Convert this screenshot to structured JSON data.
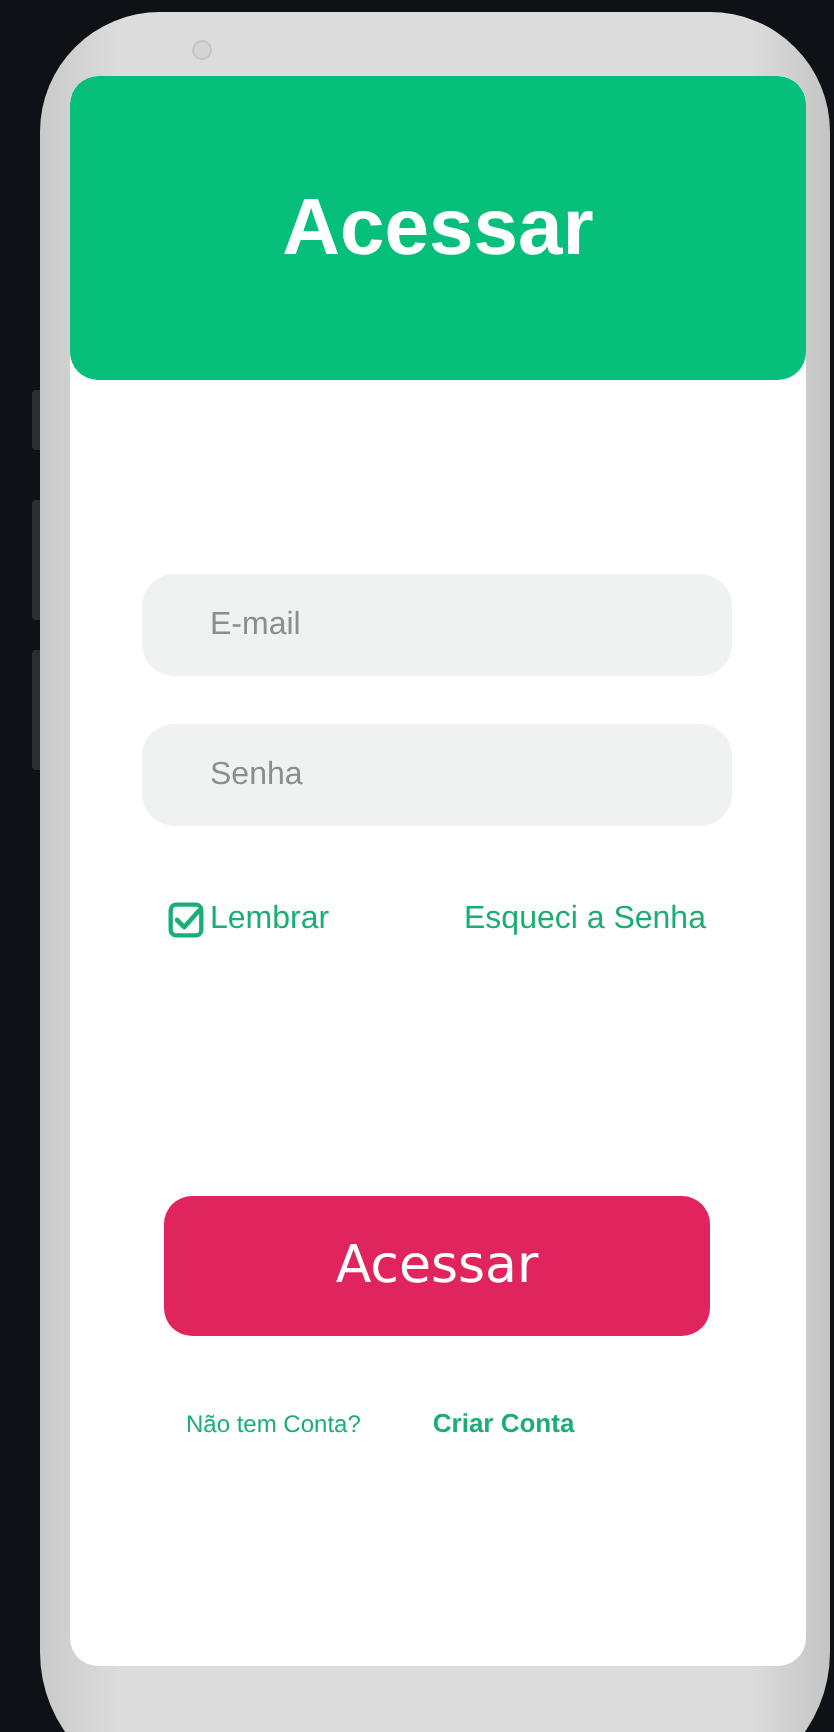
{
  "header": {
    "title": "Acessar"
  },
  "fields": [
    {
      "placeholder": "E-mail"
    },
    {
      "placeholder": "Senha"
    }
  ],
  "remember": {
    "label": "Lembrar",
    "checked": true
  },
  "forgot_link": "Esqueci a Senha",
  "submit_button": "Acessar",
  "signup": {
    "prompt": "Não tem Conta?",
    "link": "Criar Conta"
  }
}
